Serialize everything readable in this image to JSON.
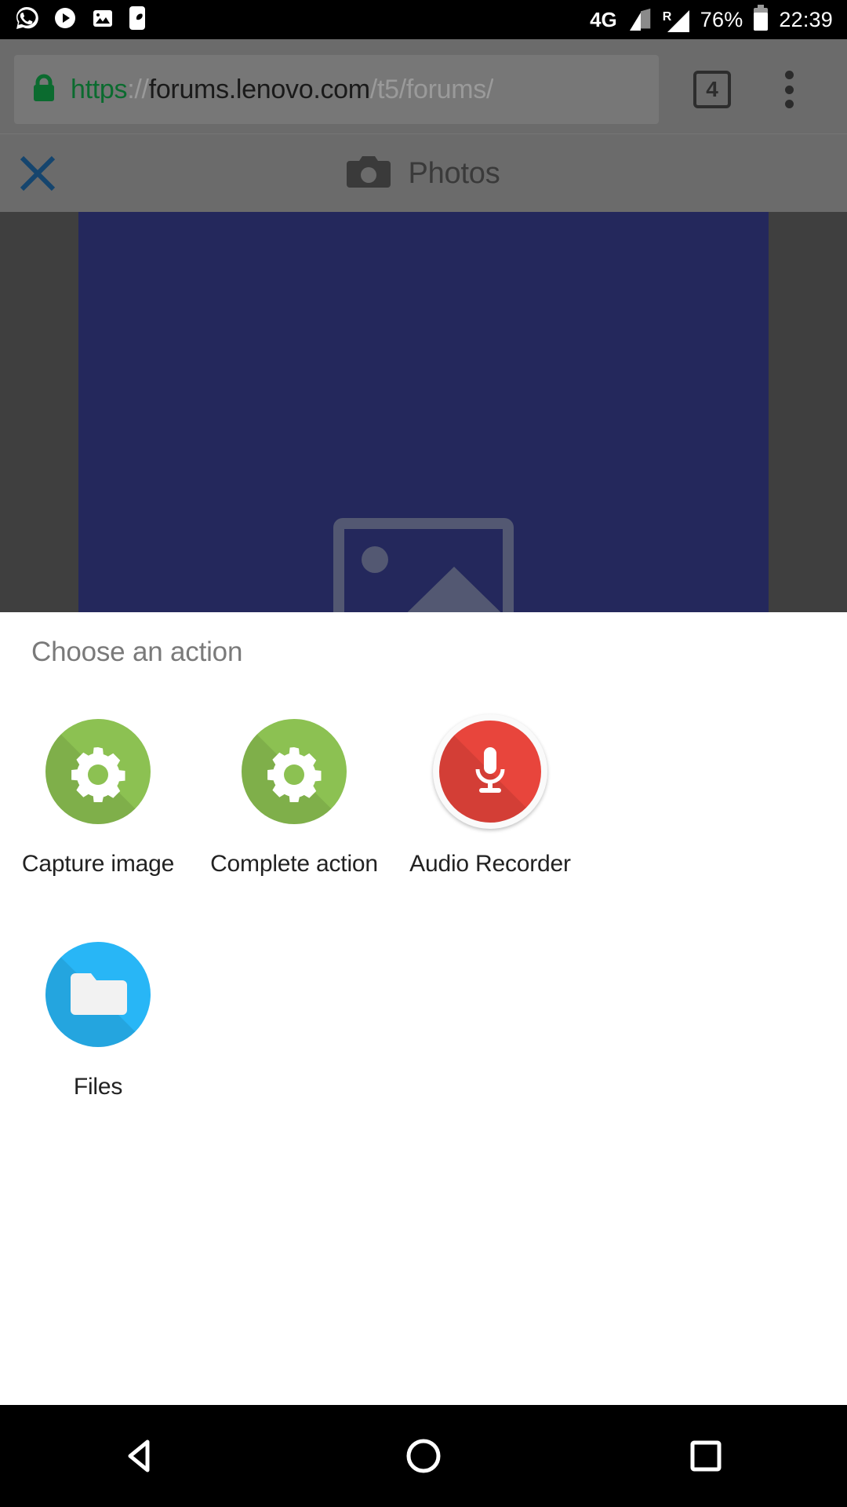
{
  "status_bar": {
    "notification_icons": [
      "whatsapp-icon",
      "play-media-icon",
      "gallery-image-icon",
      "do-not-disturb-moon-icon"
    ],
    "network_type": "4G",
    "roaming_label": "R",
    "battery_percent": "76%",
    "clock": "22:39",
    "background": "#000000",
    "foreground": "#ffffff"
  },
  "browser": {
    "url": {
      "scheme": "https",
      "separator": "://",
      "host": "forums.lenovo.com",
      "path": "/t5/forums/",
      "scheme_color": "#0b6b2f",
      "host_color": "#1a1a1a",
      "path_color": "#9a9a9a"
    },
    "lock_label": "secure-lock-icon",
    "tab_count": "4",
    "menu_label": "more-options-icon"
  },
  "picker_header": {
    "close_label": "close-icon",
    "camera_label": "camera-icon",
    "title": "Photos"
  },
  "preview": {
    "background": "#24285c",
    "placeholder": "broken-image-placeholder"
  },
  "sheet": {
    "title": "Choose an action",
    "title_color": "#7a7a7a",
    "background": "#ffffff",
    "apps": [
      {
        "label": "Capture image",
        "icon": "gear-icon",
        "color": "#8cc152"
      },
      {
        "label": "Complete action",
        "icon": "gear-icon",
        "color": "#8cc152"
      },
      {
        "label": "Audio Recorder",
        "icon": "microphone-icon",
        "color": "#e8453c"
      },
      {
        "label": "Files",
        "icon": "folder-icon",
        "color": "#28b6f6"
      }
    ]
  },
  "nav_bar": {
    "back_label": "back-triangle-icon",
    "home_label": "home-circle-icon",
    "recents_label": "recents-square-icon",
    "background": "#000000"
  }
}
